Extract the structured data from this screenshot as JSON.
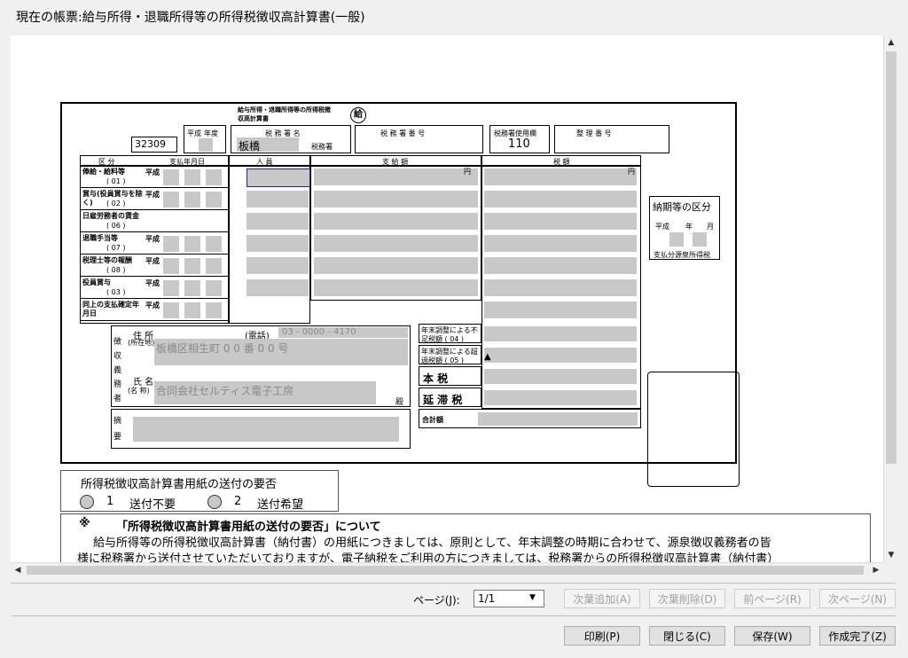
{
  "window": {
    "title": "現在の帳票:給与所得・退職所得等の所得税徴収高計算書(一般)"
  },
  "form": {
    "header_title": "給与所得・退職所得等の所得税徴収高計算書",
    "kyu_mark": "給",
    "code": "32309",
    "era_label": "平成",
    "year_label": "年度",
    "tax_office_name_label": "税 務 署 名",
    "tax_office_value": "板橋",
    "tax_office_suffix": "税務署",
    "tax_office_number_label": "税 務 署 番 号",
    "tax_office_use_label": "税務署使用欄",
    "tax_office_use_value": "110",
    "seiri_label": "整 理 番 号",
    "col_kubun": "区 分",
    "col_payment_date": "支払年月日",
    "col_people": "人 員",
    "col_payment_amount": "支 給 額",
    "col_tax_amount": "税 額",
    "unit_yen": "円",
    "rows": [
      {
        "label": "俸給・給料等",
        "code": "( 01 )",
        "era": "平成"
      },
      {
        "label": "賞与(役員賞与を除く)",
        "code": "( 02 )",
        "era": "平成"
      },
      {
        "label": "日雇労務者の賃金",
        "code": "( 06 )",
        "era": ""
      },
      {
        "label": "退職手当等",
        "code": "( 07 )",
        "era": "平成"
      },
      {
        "label": "税理士等の報酬",
        "code": "( 08 )",
        "era": "平成"
      },
      {
        "label": "役員賞与",
        "code": "( 03 )",
        "era": "平成"
      },
      {
        "label": "同上の支払確定年月日",
        "code": "",
        "era": "平成"
      }
    ],
    "month_label": "月",
    "day_label": "日",
    "year_short": "年",
    "adjust_short_label": "年末調整による不足税額 ( 04 )",
    "adjust_over_label": "年末調整による超過税額 ( 05 )",
    "honzei_label": "本 税",
    "entai_label": "延 滞 税",
    "total_label": "合計額",
    "payment_period": {
      "title": "納期等の区分",
      "era": "平成",
      "year": "年",
      "month": "月",
      "note": "支払分源泉所得税"
    },
    "address_label": "住 所",
    "address_sub": "(所在地)",
    "phone_label": "(電話)",
    "phone_value": "03 - 0000 - 4170",
    "address_value": "板橋区相生町 0 0 番 0 0 号",
    "name_label": "氏 名",
    "name_sub": "(名 称)",
    "name_value": "合同会社セルティス電子工房",
    "obligor_label": "徴収義務者",
    "dono": "殿",
    "remarks_label": "摘要"
  },
  "send_option": {
    "group_title": "所得税徴収高計算書用紙の送付の要否",
    "options": [
      {
        "num": "1",
        "label": "送付不要"
      },
      {
        "num": "2",
        "label": "送付希望"
      }
    ]
  },
  "notice": {
    "mark": "※",
    "title": "「所得税徴収高計算書用紙の送付の要否」について",
    "line1": "給与所得等の所得税徴収高計算書（納付書）の用紙につきましては、原則として、年末調整の時期に合わせて、源泉徴収義務者の皆",
    "line2": "様に税務署から送付させていただいておりますが、電子納税をご利用の方につきましては、税務署からの所得税徴収高計算書（納付書）"
  },
  "pager": {
    "label": "ページ(J):",
    "value": "1/1",
    "add_page": "次葉追加(A)",
    "delete_page": "次葉削除(D)",
    "prev_page": "前ページ(R)",
    "next_page": "次ページ(N)"
  },
  "footer": {
    "print": "印刷(P)",
    "close": "閉じる(C)",
    "save": "保存(W)",
    "complete": "作成完了(Z)"
  }
}
